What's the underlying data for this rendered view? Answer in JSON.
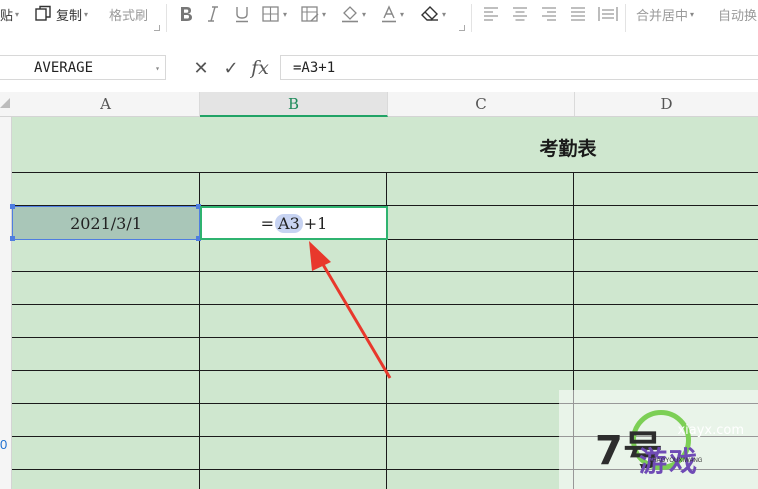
{
  "ribbon": {
    "paste_fragment": "贴",
    "copy": "复制",
    "format_painter": "格式刷",
    "merge_center": "合并居中",
    "auto_wrap_fragment": "自动换"
  },
  "formula_bar": {
    "name_box": "AVERAGE",
    "cancel_symbol": "✕",
    "confirm_symbol": "✓",
    "fx_symbol": "fx",
    "formula": "=A3+1"
  },
  "columns": [
    "A",
    "B",
    "C",
    "D"
  ],
  "sheet": {
    "title": "考勤表",
    "cell_a3": "2021/3/1",
    "edit_prefix": "=",
    "edit_ref": "A3",
    "edit_suffix": "+1"
  },
  "row_number_partial": "0",
  "watermark": {
    "site": "xiayx.com",
    "number": "7号",
    "brand": "游戏",
    "pinyin": "7HAOYOUXIWANG"
  },
  "colors": {
    "cell_fill": "#cfe7cf",
    "selection_border": "#2fb370",
    "reference_highlight": "#c7d3f2",
    "arrow": "#e8382c"
  }
}
